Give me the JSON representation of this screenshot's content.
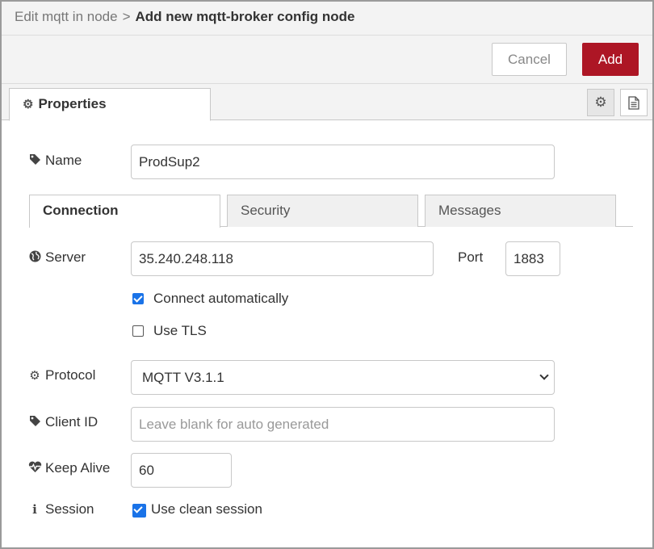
{
  "breadcrumb": {
    "parent": "Edit mqtt in node",
    "separator": ">",
    "current": "Add new mqtt-broker config node"
  },
  "toolbar": {
    "cancel_label": "Cancel",
    "add_label": "Add",
    "add_color": "#ad1625"
  },
  "properties_tab": {
    "label": "Properties",
    "icon": "gear-icon"
  },
  "side_icons": [
    "gear-icon",
    "document-icon"
  ],
  "fields": {
    "name": {
      "label": "Name",
      "value": "ProdSup2",
      "icon": "tag-icon"
    },
    "server": {
      "label": "Server",
      "value": "35.240.248.118",
      "icon": "globe-icon"
    },
    "port": {
      "label": "Port",
      "value": "1883"
    },
    "connect_auto": {
      "label": "Connect automatically",
      "checked": true
    },
    "use_tls": {
      "label": "Use TLS",
      "checked": false
    },
    "protocol": {
      "label": "Protocol",
      "value": "MQTT V3.1.1",
      "icon": "gear-icon"
    },
    "client_id": {
      "label": "Client ID",
      "placeholder": "Leave blank for auto generated",
      "icon": "tag-icon"
    },
    "keep_alive": {
      "label": "Keep Alive",
      "value": "60",
      "icon": "heartbeat-icon"
    },
    "session": {
      "label": "Session",
      "checkbox_label": "Use clean session",
      "checked": true,
      "icon": "info-icon"
    }
  },
  "tabs": [
    {
      "label": "Connection",
      "active": true
    },
    {
      "label": "Security",
      "active": false
    },
    {
      "label": "Messages",
      "active": false
    }
  ],
  "accent_color": "#1a73e8"
}
